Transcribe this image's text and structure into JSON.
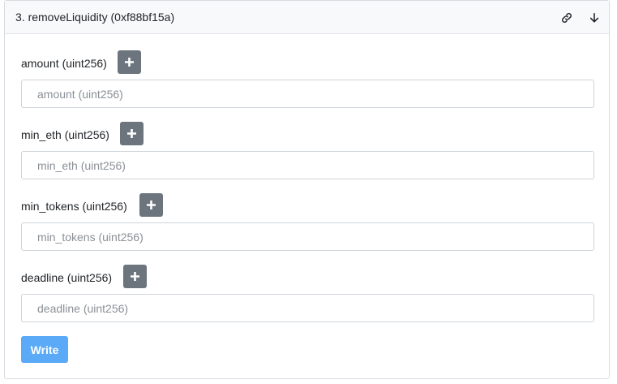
{
  "header": {
    "title": "3. removeLiquidity (0xf88bf15a)",
    "icons": [
      "link-icon",
      "arrow-down-icon"
    ]
  },
  "fields": [
    {
      "label": "amount (uint256)",
      "placeholder": "amount (uint256)",
      "value": ""
    },
    {
      "label": "min_eth (uint256)",
      "placeholder": "min_eth (uint256)",
      "value": ""
    },
    {
      "label": "min_tokens (uint256)",
      "placeholder": "min_tokens (uint256)",
      "value": ""
    },
    {
      "label": "deadline (uint256)",
      "placeholder": "deadline (uint256)",
      "value": ""
    }
  ],
  "actions": {
    "write_label": "Write"
  },
  "colors": {
    "header_bg": "#f8f9fa",
    "plus_button": "#6c757d",
    "write_button": "#5aaaf8"
  }
}
